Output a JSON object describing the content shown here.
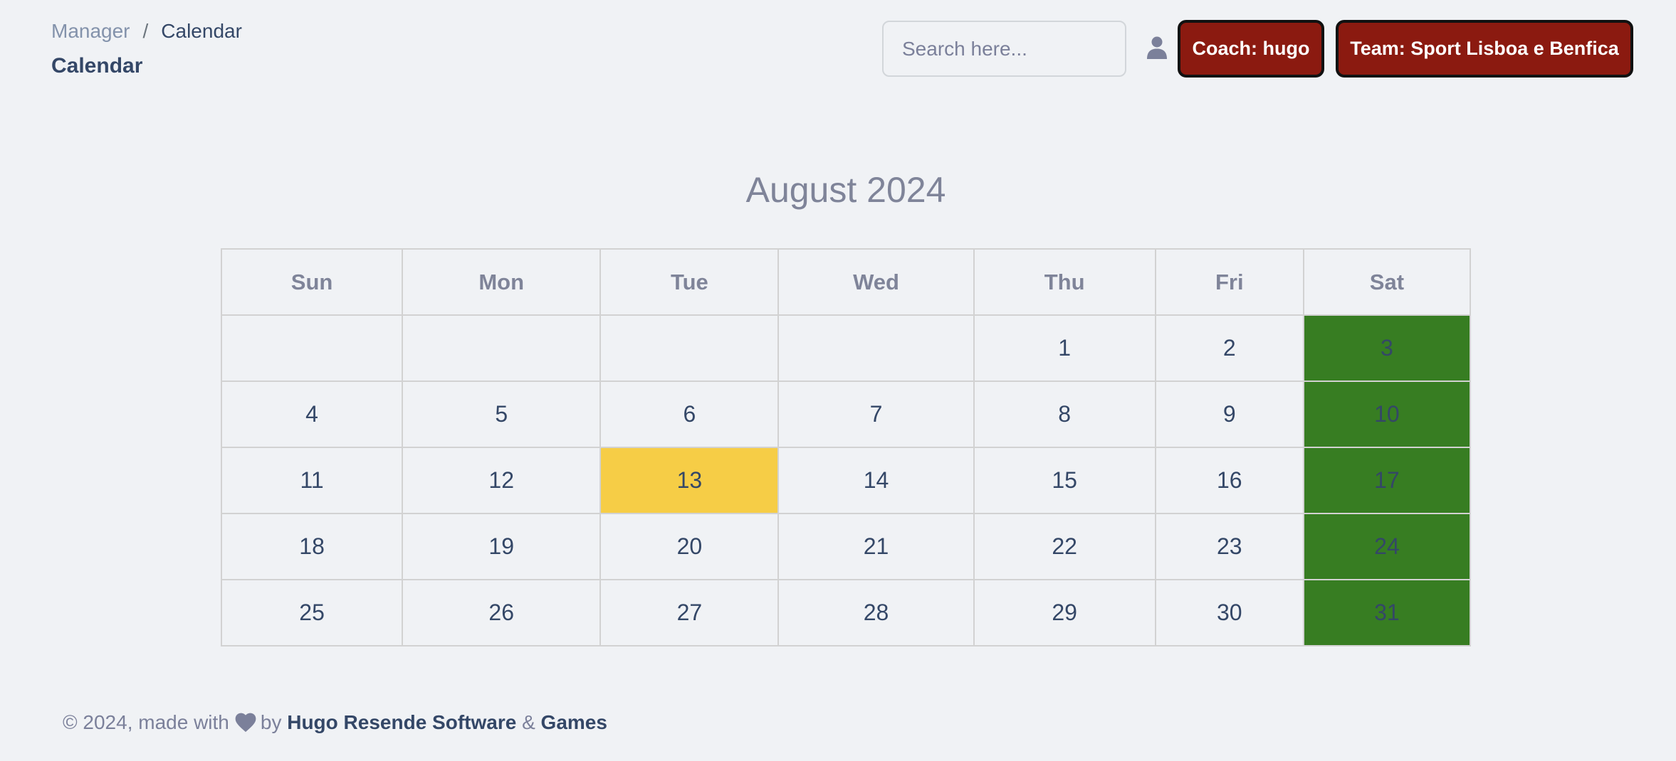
{
  "breadcrumb": {
    "parent": "Manager",
    "separator": "/",
    "current": "Calendar"
  },
  "page_title": "Calendar",
  "search": {
    "placeholder": "Search here...",
    "value": ""
  },
  "header": {
    "coach_label": "Coach: hugo",
    "team_label": "Team: Sport Lisboa e Benfica"
  },
  "colors": {
    "header_button": "#8b1a10",
    "weekend": "#377d22",
    "today": "#f6cd46"
  },
  "calendar": {
    "title": "August 2024",
    "weekdays": [
      "Sun",
      "Mon",
      "Tue",
      "Wed",
      "Thu",
      "Fri",
      "Sat"
    ],
    "weeks": [
      [
        "",
        "",
        "",
        "",
        "1",
        "2",
        "3"
      ],
      [
        "4",
        "5",
        "6",
        "7",
        "8",
        "9",
        "10"
      ],
      [
        "11",
        "12",
        "13",
        "14",
        "15",
        "16",
        "17"
      ],
      [
        "18",
        "19",
        "20",
        "21",
        "22",
        "23",
        "24"
      ],
      [
        "25",
        "26",
        "27",
        "28",
        "29",
        "30",
        "31"
      ]
    ],
    "highlighted_day": "13",
    "weekend_column": "Sat"
  },
  "footer": {
    "prefix": "© 2024, made with",
    "icon": "heart-icon",
    "by": "by",
    "company": "Hugo Resende Software",
    "amp": "&",
    "games": "Games"
  }
}
